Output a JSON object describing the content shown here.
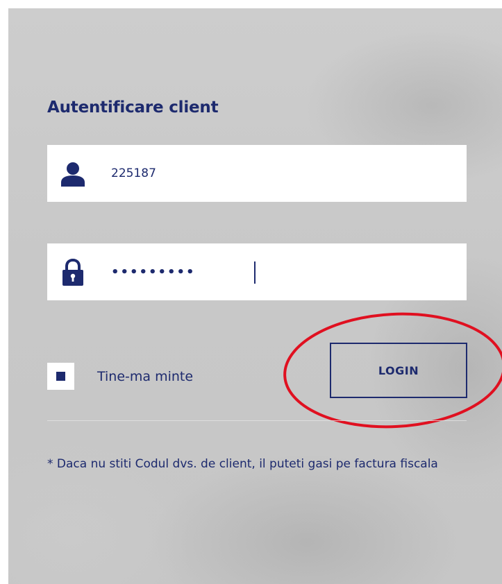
{
  "login_form": {
    "title": "Autentificare client",
    "client_code": {
      "value": "225187",
      "icon": "user-icon"
    },
    "password": {
      "value": "password1",
      "icon": "lock-icon"
    },
    "remember_me": {
      "label": "Tine-ma minte",
      "checked": true
    },
    "login_button": {
      "label": "LOGIN"
    },
    "hint": "* Daca nu stiti Codul dvs. de client, il puteti gasi pe factura fiscala"
  },
  "colors": {
    "brand": "#1d2a6e",
    "annotation": "#e01020",
    "field_background": "#ffffff"
  }
}
